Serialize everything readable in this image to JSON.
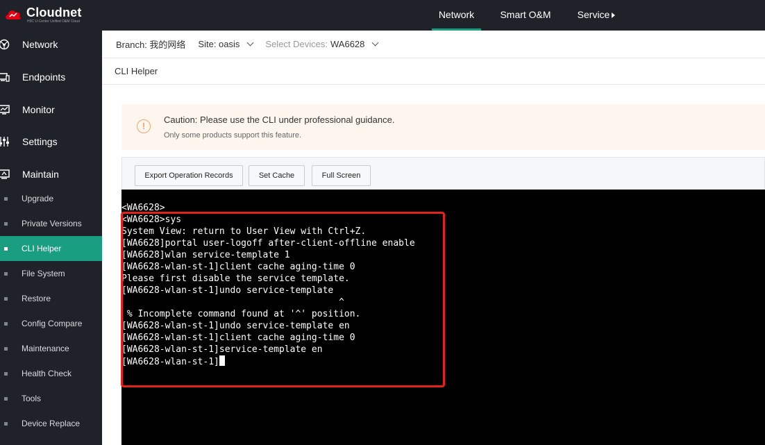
{
  "brand": {
    "name": "Cloudnet",
    "tagline": "H3C U-Center Unified O&M Cloud",
    "color": "#e60012"
  },
  "topnav": {
    "items": [
      {
        "label": "Network",
        "active": true
      },
      {
        "label": "Smart O&M",
        "active": false
      },
      {
        "label": "Service",
        "active": false
      }
    ]
  },
  "sidebar": {
    "main": [
      {
        "label": "Network",
        "icon": "network-icon"
      },
      {
        "label": "Endpoints",
        "icon": "endpoints-icon"
      },
      {
        "label": "Monitor",
        "icon": "monitor-icon"
      },
      {
        "label": "Settings",
        "icon": "settings-sliders-icon"
      },
      {
        "label": "Maintain",
        "icon": "maintain-icon"
      }
    ],
    "sub": [
      {
        "label": "Upgrade",
        "active": false
      },
      {
        "label": "Private Versions",
        "active": false
      },
      {
        "label": "CLI Helper",
        "active": true
      },
      {
        "label": "File System",
        "active": false
      },
      {
        "label": "Restore",
        "active": false
      },
      {
        "label": "Config Compare",
        "active": false
      },
      {
        "label": "Maintenance",
        "active": false
      },
      {
        "label": "Health Check",
        "active": false
      },
      {
        "label": "Tools",
        "active": false
      },
      {
        "label": "Device Replace",
        "active": false
      }
    ]
  },
  "breadcrumb": {
    "branch": "Branch: 我的网络",
    "site": "Site: oasis",
    "devices_label": "Select Devices:",
    "devices_value": "WA6628"
  },
  "page": {
    "title": "CLI Helper"
  },
  "caution": {
    "title": "Caution: Please use the CLI under professional guidance.",
    "subtitle": "Only some products support this feature.",
    "icon": "warning-circle-icon",
    "color": "#f0a46b"
  },
  "toolbar": {
    "export_label": "Export Operation Records",
    "cache_label": "Set Cache",
    "fullscreen_label": "Full Screen"
  },
  "terminal": {
    "lines": [
      "<WA6628>",
      "<WA6628>sys",
      "System View: return to User View with Ctrl+Z.",
      "[WA6628]portal user-logoff after-client-offline enable",
      "[WA6628]wlan service-template 1",
      "[WA6628-wlan-st-1]client cache aging-time 0",
      "Please first disable the service template.",
      "[WA6628-wlan-st-1]undo service-template",
      "                                        ^",
      " % Incomplete command found at '^' position.",
      "[WA6628-wlan-st-1]undo service-template en",
      "[WA6628-wlan-st-1]client cache aging-time 0",
      "[WA6628-wlan-st-1]service-template en",
      "[WA6628-wlan-st-1]"
    ],
    "highlight_color": "#e3221b"
  },
  "theme": {
    "sidebar_bg": "#1f2329",
    "accent": "#1a9e82"
  }
}
